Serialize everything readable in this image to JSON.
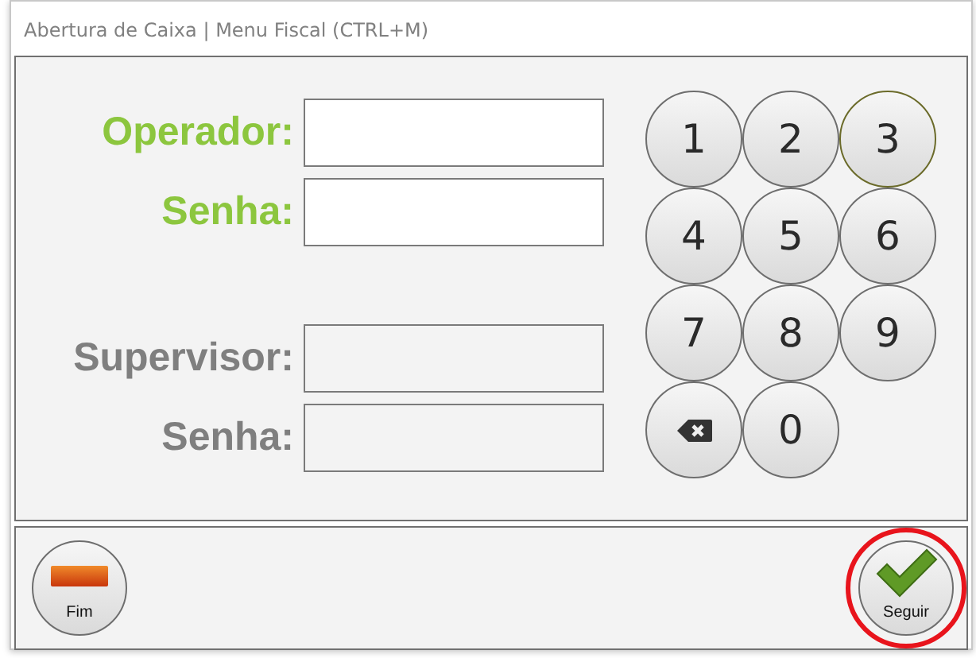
{
  "window": {
    "title": "Abertura de Caixa | Menu Fiscal (CTRL+M)"
  },
  "field_groups": [
    {
      "fields": [
        {
          "label": "Operador:",
          "active": true
        },
        {
          "label": "Senha:",
          "active": true
        }
      ]
    },
    {
      "fields": [
        {
          "label": "Supervisor:",
          "active": false
        },
        {
          "label": "Senha:",
          "active": false
        }
      ]
    }
  ],
  "keypad": [
    {
      "kind": "digit",
      "label": "1",
      "focused": false
    },
    {
      "kind": "digit",
      "label": "2",
      "focused": false
    },
    {
      "kind": "digit",
      "label": "3",
      "focused": true
    },
    {
      "kind": "digit",
      "label": "4",
      "focused": false
    },
    {
      "kind": "digit",
      "label": "5",
      "focused": false
    },
    {
      "kind": "digit",
      "label": "6",
      "focused": false
    },
    {
      "kind": "digit",
      "label": "7",
      "focused": false
    },
    {
      "kind": "digit",
      "label": "8",
      "focused": false
    },
    {
      "kind": "digit",
      "label": "9",
      "focused": false
    },
    {
      "kind": "backspace",
      "focused": false
    },
    {
      "kind": "digit",
      "label": "0",
      "focused": false
    }
  ],
  "footer_buttons": [
    {
      "kind": "end",
      "label": "Fim",
      "highlighted": false
    },
    {
      "kind": "continue",
      "label": "Seguir",
      "highlighted": true
    }
  ]
}
